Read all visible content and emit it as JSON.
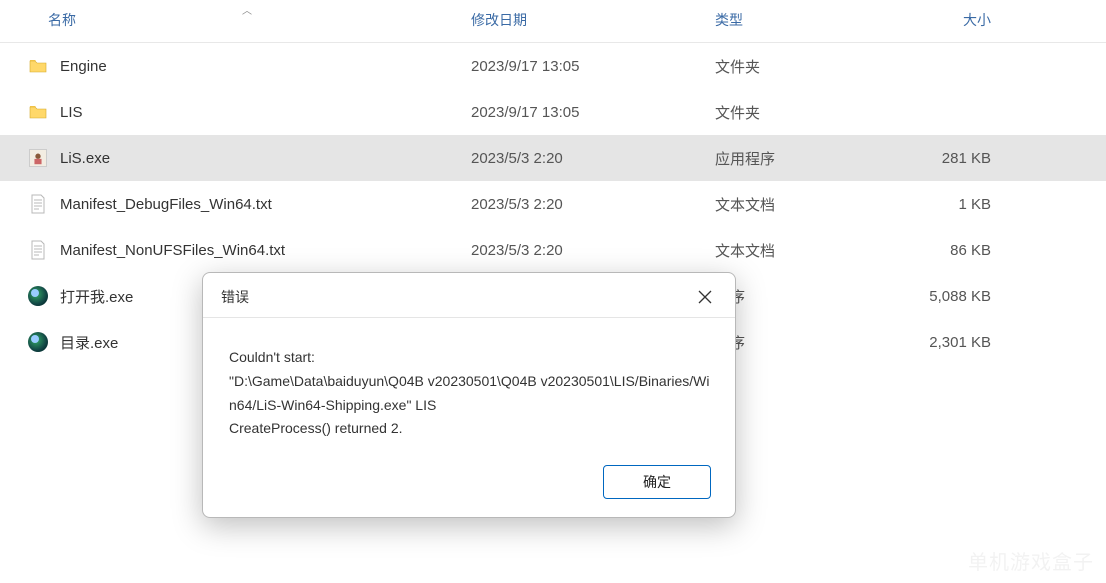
{
  "header": {
    "name": "名称",
    "date": "修改日期",
    "type": "类型",
    "size": "大小",
    "sort_column": "name",
    "sort_asc": true
  },
  "rows": [
    {
      "icon": "folder",
      "name": "Engine",
      "date": "2023/9/17 13:05",
      "type": "文件夹",
      "size": "",
      "selected": false
    },
    {
      "icon": "folder",
      "name": "LIS",
      "date": "2023/9/17 13:05",
      "type": "文件夹",
      "size": "",
      "selected": false
    },
    {
      "icon": "exe-lis",
      "name": "LiS.exe",
      "date": "2023/5/3 2:20",
      "type": "应用程序",
      "size": "281 KB",
      "selected": true
    },
    {
      "icon": "txt",
      "name": "Manifest_DebugFiles_Win64.txt",
      "date": "2023/5/3 2:20",
      "type": "文本文档",
      "size": "1 KB",
      "selected": false
    },
    {
      "icon": "txt",
      "name": "Manifest_NonUFSFiles_Win64.txt",
      "date": "2023/5/3 2:20",
      "type": "文本文档",
      "size": "86 KB",
      "selected": false
    },
    {
      "icon": "round",
      "name": "打开我.exe",
      "date": "",
      "type": "程序",
      "size": "5,088 KB",
      "selected": false
    },
    {
      "icon": "round",
      "name": "目录.exe",
      "date": "",
      "type": "程序",
      "size": "2,301 KB",
      "selected": false
    }
  ],
  "dialog": {
    "title": "错误",
    "message": "Couldn't start:\n\"D:\\Game\\Data\\baiduyun\\Q04B v20230501\\Q04B v20230501\\LIS/Binaries/Win64/LiS-Win64-Shipping.exe\" LIS\nCreateProcess() returned 2.",
    "ok_label": "确定"
  },
  "watermark": "单机游戏盒子"
}
